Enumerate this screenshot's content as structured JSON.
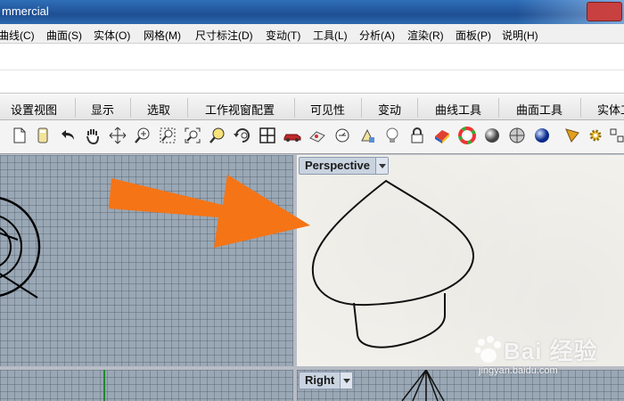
{
  "window": {
    "title": "mmercial"
  },
  "menus": [
    "曲线(C)",
    "曲面(S)",
    "实体(O)",
    "网格(M)",
    "尺寸标注(D)",
    "变动(T)",
    "工具(L)",
    "分析(A)",
    "渲染(R)",
    "面板(P)",
    "说明(H)"
  ],
  "tabs": [
    "设置视图",
    "显示",
    "选取",
    "工作视窗配置",
    "可见性",
    "变动",
    "曲线工具",
    "曲面工具",
    "实体工"
  ],
  "toolbar_icons": [
    "new-document-icon",
    "open-file-icon",
    "undo-icon",
    "pan-hand-icon",
    "move-view-icon",
    "zoom-dynamic-icon",
    "zoom-window-icon",
    "zoom-extents-icon",
    "zoom-selected-icon",
    "rotate-view-icon",
    "four-viewports-icon",
    "car-icon",
    "named-views-icon",
    "set-cplane-icon",
    "cplane-origin-icon",
    "light-bulb-icon",
    "lock-icon",
    "material-icon",
    "color-wheel-icon",
    "shaded-sphere-icon",
    "render-sphere-icon",
    "blue-sphere-icon",
    "properties-icon",
    "options-gear-icon",
    "more-icon"
  ],
  "viewports": {
    "perspective_label": "Perspective",
    "right_label": "Right"
  },
  "watermark": {
    "brand": "Bai  经验",
    "url": "jingyan.baidu.com"
  },
  "colors": {
    "arrow": "#f57416",
    "title_bar": "#1f4f93",
    "viewport_grid": "#9aa7b5",
    "perspective_bg": "#f2f1ec"
  }
}
